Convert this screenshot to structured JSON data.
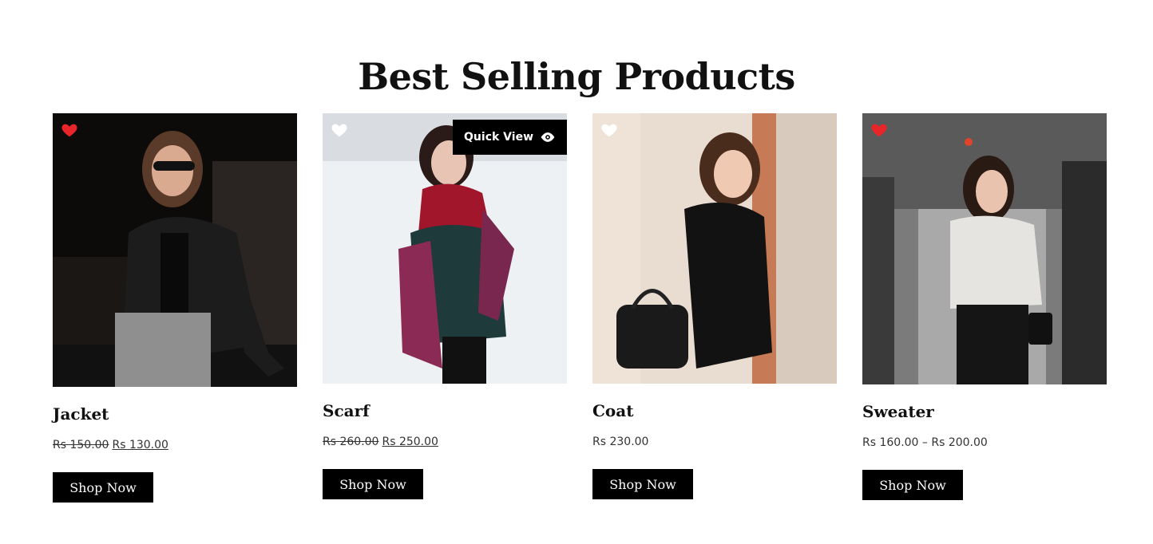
{
  "section": {
    "title": "Best Selling Products"
  },
  "products": [
    {
      "name": "Jacket",
      "old_price": "Rs 150.00",
      "price": "Rs 130.00",
      "button": "Shop Now",
      "wishlisted": true
    },
    {
      "name": "Scarf",
      "old_price": "Rs 260.00",
      "price": "Rs 250.00",
      "button": "Shop Now",
      "wishlisted": false,
      "quick_view": "Quick View"
    },
    {
      "name": "Coat",
      "price": "Rs 230.00",
      "button": "Shop Now",
      "wishlisted": false
    },
    {
      "name": "Sweater",
      "price": "Rs 160.00 – Rs 200.00",
      "button": "Shop Now",
      "wishlisted": true
    }
  ],
  "colors": {
    "heart_active": "#e8262a",
    "heart_inactive": "#ffffff",
    "button_bg": "#000000"
  },
  "icons": {
    "wishlist": "heart-icon",
    "quick_view": "eye-icon"
  }
}
